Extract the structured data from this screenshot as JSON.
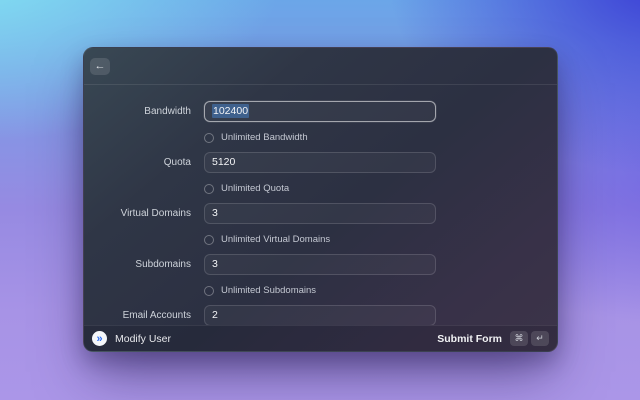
{
  "header": {
    "back_icon": "←"
  },
  "form": {
    "rows": [
      {
        "label": "Bandwidth",
        "value": "102400",
        "checkbox_label": "Unlimited Bandwidth"
      },
      {
        "label": "Quota",
        "value": "5120",
        "checkbox_label": "Unlimited Quota"
      },
      {
        "label": "Virtual Domains",
        "value": "3",
        "checkbox_label": "Unlimited Virtual Domains"
      },
      {
        "label": "Subdomains",
        "value": "3",
        "checkbox_label": "Unlimited Subdomains"
      },
      {
        "label": "Email Accounts",
        "value": "2"
      }
    ]
  },
  "footer": {
    "app_icon": "»",
    "title": "Modify User",
    "submit_label": "Submit Form",
    "shortcut_keys": [
      "⌘",
      "↵"
    ]
  },
  "colors": {
    "selection_highlight": "#3f618d",
    "accent_blue": "#2f6ff0",
    "bg_top_left": "#86e7f3",
    "bg_top_right": "#3836d4",
    "bg_bottom": "#a793e6",
    "modal_dark": "#2c3042"
  }
}
